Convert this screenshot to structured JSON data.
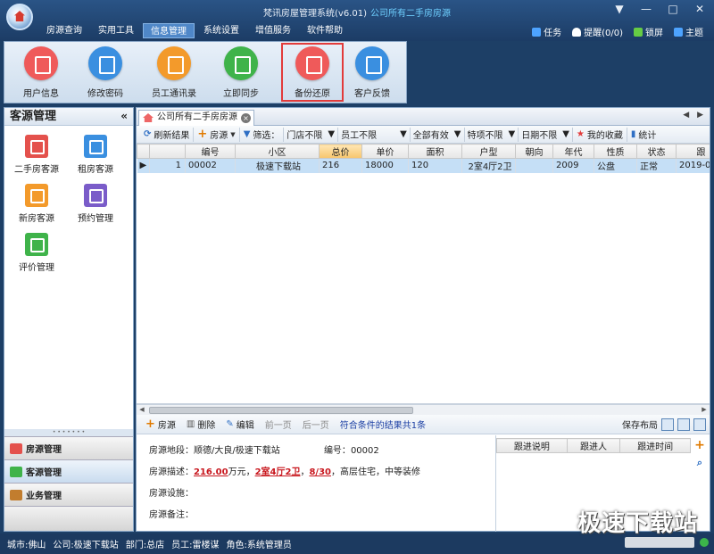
{
  "app": {
    "title": "梵讯房屋管理系统(v6.01)",
    "subtitle": "公司所有二手房房源"
  },
  "window_controls": [
    "▼",
    "—",
    "□",
    "✕"
  ],
  "menu": [
    "房源查询",
    "实用工具",
    "信息管理",
    "系统设置",
    "增值服务",
    "软件帮助"
  ],
  "top_right": [
    {
      "label": "任务",
      "icon": "checkbox-icon",
      "color": "#4da3ff"
    },
    {
      "label": "提醒(0/0)",
      "icon": "bell-icon",
      "color": "#ffffff"
    },
    {
      "label": "锁屏",
      "icon": "lock-icon",
      "color": "#66cc44"
    },
    {
      "label": "主题",
      "icon": "shirt-icon",
      "color": "#4da3ff"
    }
  ],
  "ribbon": [
    {
      "label": "用户信息",
      "icon": "user-info-icon",
      "color": "#ef5a5a"
    },
    {
      "label": "修改密码",
      "icon": "lock-icon",
      "color": "#3a8fe0"
    },
    {
      "label": "员工通讯录",
      "icon": "contacts-icon",
      "color": "#f39a2b"
    },
    {
      "label": "立即同步",
      "icon": "cloud-sync-icon",
      "color": "#3fb34a"
    },
    {
      "label": "备份还原",
      "icon": "backup-restore-icon",
      "color": "#ef5a5a"
    },
    {
      "label": "客户反馈",
      "icon": "mail-icon",
      "color": "#3a8fe0"
    }
  ],
  "left": {
    "title": "客源管理",
    "collapse": "«",
    "modules": [
      {
        "label": "二手房客源",
        "icon": "house-icon",
        "color": "#e4514c"
      },
      {
        "label": "租房客源",
        "icon": "rent-icon",
        "color": "#3a8fe0"
      },
      {
        "label": "新房客源",
        "icon": "building-icon",
        "color": "#f39a2b"
      },
      {
        "label": "预约管理",
        "icon": "calendar-icon",
        "color": "#7a5cc9"
      },
      {
        "label": "评价管理",
        "icon": "edit-icon",
        "color": "#3fb34a"
      }
    ],
    "nav": [
      {
        "label": "房源管理",
        "icon": "house-nav-icon",
        "color": "#e4514c"
      },
      {
        "label": "客源管理",
        "icon": "people-nav-icon",
        "color": "#3fb34a"
      },
      {
        "label": "业务管理",
        "icon": "briefcase-nav-icon",
        "color": "#c27d2e"
      }
    ],
    "grip": "• • • • • • •"
  },
  "tab": {
    "label": "公司所有二手房房源",
    "close": "×",
    "nav": "◀ ▶"
  },
  "toolbar": {
    "refresh": "刷新结果",
    "add": "房源",
    "filter": "筛选：",
    "store": "门店不限",
    "staff": "员工不限",
    "valid": "全部有效",
    "special": "特项不限",
    "date": "日期不限",
    "favorites": "我的收藏",
    "stats": "统计"
  },
  "grid": {
    "columns": [
      "",
      "",
      "编号",
      "小区",
      "总价",
      "单价",
      "面积",
      "户型",
      "朝向",
      "年代",
      "性质",
      "状态",
      "跟"
    ],
    "rows": [
      [
        "▶",
        "1",
        "00002",
        "极速下载站",
        "216",
        "18000",
        "120",
        "2室4厅2卫",
        "",
        "2009",
        "公盘",
        "正常",
        "2019-0"
      ]
    ]
  },
  "toolbar2": {
    "add": "房源",
    "delete": "删除",
    "edit": "编辑",
    "prev": "前一页",
    "next": "后一页",
    "count": "符合条件的结果共1条",
    "save_layout": "保存布局"
  },
  "detail": {
    "location_label": "房源地段：",
    "location": "顺德/大良/极速下载站",
    "id_label": "编号：",
    "id": "00002",
    "desc_label": "房源描述：",
    "price": "216.00",
    "price_unit": "万元，",
    "layout": "2室4厅2卫",
    "floor": "8/30",
    "desc_tail": "高层住宅，中等装修",
    "facility_label": "房源设施：",
    "note_label": "房源备注："
  },
  "follow": {
    "columns": [
      "跟进说明",
      "跟进人",
      "跟进时间"
    ]
  },
  "status": [
    "城市:佛山",
    "公司:极速下载站",
    "部门:总店",
    "员工:雷楼谋",
    "角色:系统管理员"
  ],
  "watermark": "极速下载站"
}
